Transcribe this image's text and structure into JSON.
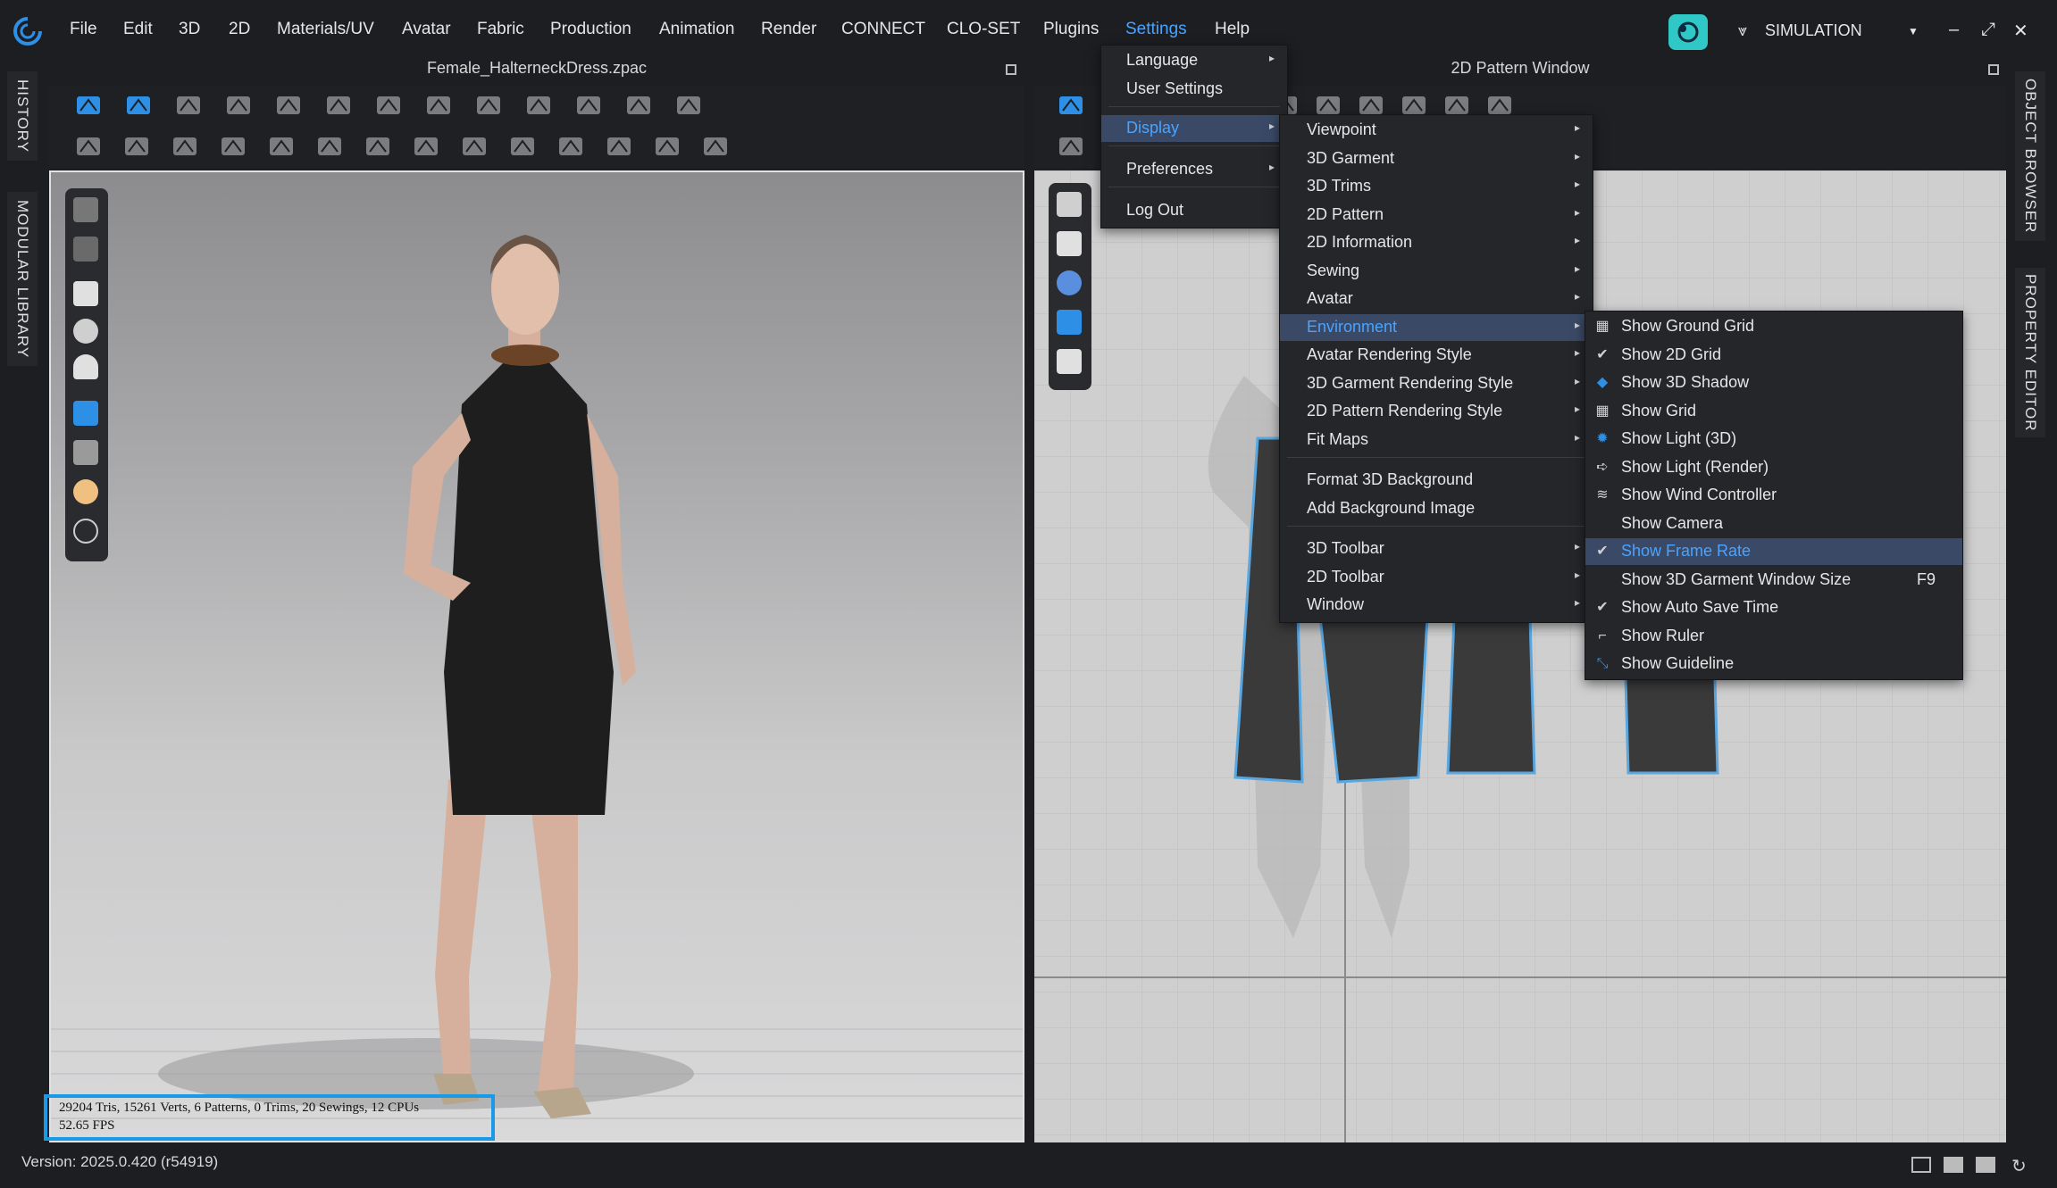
{
  "menubar": {
    "items": [
      "File",
      "Edit",
      "3D",
      "2D",
      "Materials/UV",
      "Avatar",
      "Fabric",
      "Production",
      "Animation",
      "Render",
      "CONNECT",
      "CLO-SET",
      "Plugins",
      "Settings",
      "Help"
    ],
    "mode": "SIMULATION",
    "mode_arrow": "▼",
    "minimize": "–",
    "maximize": "⤢",
    "close": "✕"
  },
  "side_tabs": {
    "history": "HISTORY",
    "modular_library": "MODULAR LIBRARY",
    "object_browser": "OBJECT BROWSER",
    "property_editor": "PROPERTY EDITOR"
  },
  "panels": {
    "view3d_title": "Female_HalterneckDress.zpac",
    "view2d_title": "2D Pattern Window"
  },
  "stats": {
    "line1": "29204 Tris, 15261 Verts, 6 Patterns, 0 Trims, 20 Sewings, 12 CPUs",
    "line2": "52.65 FPS"
  },
  "status": {
    "version": "Version: 2025.0.420 (r54919)"
  },
  "settings_menu": {
    "items": [
      {
        "label": "Language",
        "submenu": true
      },
      {
        "label": "User Settings",
        "submenu": false
      },
      {
        "label": "Display",
        "submenu": true,
        "highlighted": true
      },
      {
        "label": "Preferences",
        "submenu": true
      },
      {
        "label": "Log Out",
        "submenu": false
      }
    ]
  },
  "display_menu": {
    "items": [
      {
        "label": "Viewpoint",
        "submenu": true
      },
      {
        "label": "3D Garment",
        "submenu": true
      },
      {
        "label": "3D Trims",
        "submenu": true
      },
      {
        "label": "2D Pattern",
        "submenu": true
      },
      {
        "label": "2D Information",
        "submenu": true
      },
      {
        "label": "Sewing",
        "submenu": true
      },
      {
        "label": "Avatar",
        "submenu": true
      },
      {
        "label": "Environment",
        "submenu": true,
        "highlighted": true
      },
      {
        "label": "Avatar Rendering Style",
        "submenu": true
      },
      {
        "label": "3D Garment Rendering Style",
        "submenu": true
      },
      {
        "label": "2D Pattern Rendering Style",
        "submenu": true
      },
      {
        "label": "Fit Maps",
        "submenu": true
      },
      {
        "label": "Format 3D Background",
        "submenu": false
      },
      {
        "label": "Add Background Image",
        "submenu": false
      },
      {
        "label": "3D Toolbar",
        "submenu": true
      },
      {
        "label": "2D Toolbar",
        "submenu": true
      },
      {
        "label": "Window",
        "submenu": true
      }
    ]
  },
  "environment_menu": {
    "items": [
      {
        "label": "Show Ground Grid",
        "icon": "ground-grid-icon",
        "checked": false
      },
      {
        "label": "Show 2D Grid",
        "icon": "check-icon",
        "checked": true
      },
      {
        "label": "Show 3D Shadow",
        "icon": "shadow-cube-icon",
        "checked": false
      },
      {
        "label": "Show Grid",
        "icon": "grid-icon",
        "checked": false
      },
      {
        "label": "Show Light (3D)",
        "icon": "light-icon",
        "checked": false
      },
      {
        "label": "Show Light (Render)",
        "icon": "render-light-icon",
        "checked": false
      },
      {
        "label": "Show Wind Controller",
        "icon": "wind-icon",
        "checked": false
      },
      {
        "label": "Show Camera",
        "icon": "",
        "checked": false
      },
      {
        "label": "Show Frame Rate",
        "icon": "check-icon",
        "checked": true,
        "highlighted": true
      },
      {
        "label": "Show 3D Garment Window Size",
        "icon": "",
        "checked": false,
        "shortcut": "F9"
      },
      {
        "label": "Show Auto Save Time",
        "icon": "check-icon",
        "checked": true
      },
      {
        "label": "Show Ruler",
        "icon": "ruler-icon",
        "checked": false
      },
      {
        "label": "Show Guideline",
        "icon": "guideline-icon",
        "checked": false
      }
    ]
  },
  "colors": {
    "accent": "#4aa3ff",
    "highlight": "#3a4a66",
    "frame_box": "#1a9ae6",
    "pattern_outline": "#5aa7e0"
  }
}
